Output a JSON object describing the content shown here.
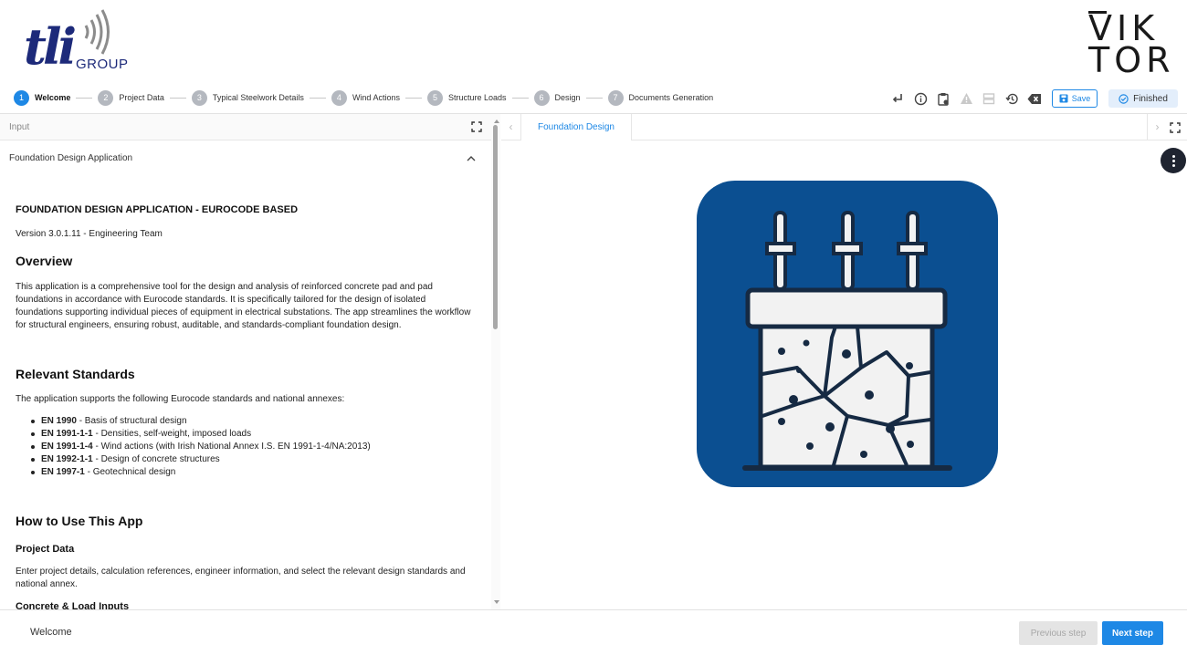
{
  "header": {
    "tli_logo_text": "tli",
    "tli_logo_group": "GROUP",
    "viktor_line1": "VIK",
    "viktor_line2": "TOR"
  },
  "stepper": {
    "steps": [
      {
        "num": "1",
        "label": "Welcome"
      },
      {
        "num": "2",
        "label": "Project Data"
      },
      {
        "num": "3",
        "label": "Typical Steelwork Details"
      },
      {
        "num": "4",
        "label": "Wind Actions"
      },
      {
        "num": "5",
        "label": "Structure Loads"
      },
      {
        "num": "6",
        "label": "Design"
      },
      {
        "num": "7",
        "label": "Documents Generation"
      }
    ]
  },
  "toolbar": {
    "save_label": "Save",
    "finished_label": "Finished"
  },
  "left": {
    "input_label": "Input",
    "section_title": "Foundation Design Application"
  },
  "doc": {
    "app_title": "FOUNDATION DESIGN APPLICATION - EUROCODE BASED",
    "version": "Version 3.0.1.11 - Engineering Team",
    "overview_heading": "Overview",
    "overview_text": "This application is a comprehensive tool for the design and analysis of reinforced concrete pad and pad foundations in accordance with Eurocode standards. It is specifically tailored for the design of isolated foundations supporting individual pieces of equipment in electrical substations. The app streamlines the workflow for structural engineers, ensuring robust, auditable, and standards-compliant foundation design.",
    "standards_heading": "Relevant Standards",
    "standards_intro": "The application supports the following Eurocode standards and national annexes:",
    "standards": [
      {
        "code": "EN 1990",
        "desc": " - Basis of structural design"
      },
      {
        "code": "EN 1991-1-1",
        "desc": " - Densities, self-weight, imposed loads"
      },
      {
        "code": "EN 1991-1-4",
        "desc": " - Wind actions (with Irish National Annex I.S. EN 1991-1-4/NA:2013)"
      },
      {
        "code": "EN 1992-1-1",
        "desc": " - Design of concrete structures"
      },
      {
        "code": "EN 1997-1",
        "desc": " - Geotechnical design"
      }
    ],
    "howto_heading": "How to Use This App",
    "project_data_heading": "Project Data",
    "project_data_text": "Enter project details, calculation references, engineer information, and select the relevant design standards and national annex.",
    "cutoff_heading": "Concrete & Load Inputs"
  },
  "right": {
    "tab_label": "Foundation Design",
    "arrow_left": "‹",
    "arrow_right": "›"
  },
  "footer": {
    "step_name": "Welcome",
    "prev_label": "Previous step",
    "next_label": "Next step"
  },
  "colors": {
    "accent": "#1e88e5",
    "illustration_bg": "#0b4f91",
    "illustration_ink": "#162a43"
  }
}
